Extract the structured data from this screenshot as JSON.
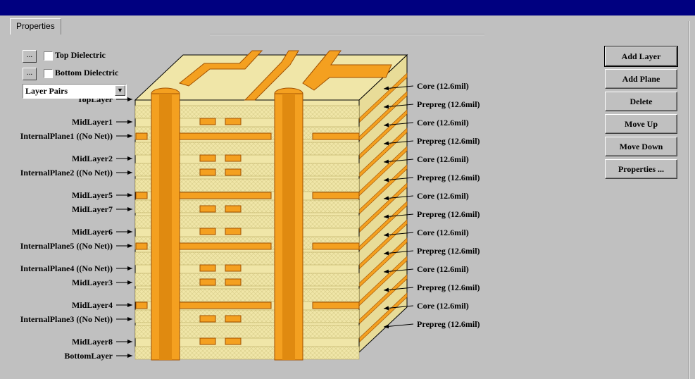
{
  "dialog": {
    "tab_label": "Properties"
  },
  "top_dielectric": {
    "button_label": "...",
    "label": "Top Dielectric"
  },
  "bottom_dielectric": {
    "button_label": "...",
    "label": "Bottom Dielectric"
  },
  "view_select": {
    "value": "Layer Pairs"
  },
  "buttons": {
    "add_layer": "Add Layer",
    "add_plane": "Add Plane",
    "delete": "Delete",
    "move_up": "Move Up",
    "move_down": "Move Down",
    "properties": "Properties ..."
  },
  "stack_layers": [
    "TopLayer",
    "MidLayer1",
    "InternalPlane1 ((No Net))",
    "MidLayer2",
    "InternalPlane2 ((No Net))",
    "MidLayer5",
    "MidLayer7",
    "MidLayer6",
    "InternalPlane5 ((No Net))",
    "InternalPlane4 ((No Net))",
    "MidLayer3",
    "MidLayer4",
    "InternalPlane3 ((No Net))",
    "MidLayer8",
    "BottomLayer"
  ],
  "dielectrics": [
    "Core (12.6mil)",
    "Prepreg (12.6mil)",
    "Core (12.6mil)",
    "Prepreg (12.6mil)",
    "Core (12.6mil)",
    "Prepreg (12.6mil)",
    "Core (12.6mil)",
    "Prepreg (12.6mil)",
    "Core (12.6mil)",
    "Prepreg (12.6mil)",
    "Core (12.6mil)",
    "Prepreg (12.6mil)",
    "Core (12.6mil)",
    "Prepreg (12.6mil)"
  ],
  "colors": {
    "titlebar": "#000080",
    "copper": "#f4a020",
    "dielectric": "#f0e6a8",
    "face": "#c0c0c0"
  }
}
